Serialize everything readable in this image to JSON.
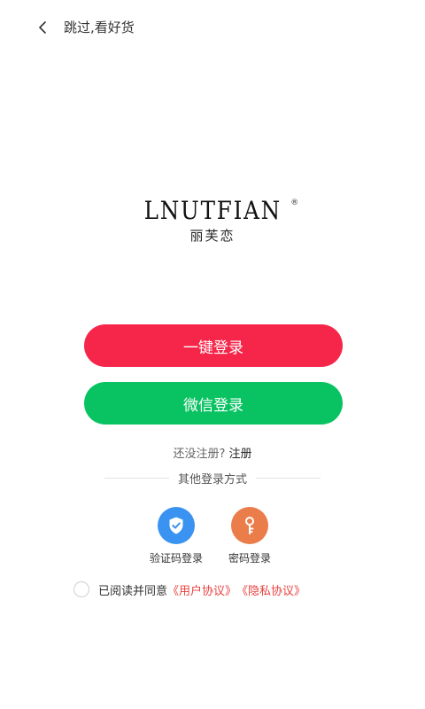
{
  "header": {
    "back_label": "跳过,看好货"
  },
  "logo": {
    "brand": "LNUTFIAN",
    "registered_mark": "®",
    "chinese": "丽芙恋"
  },
  "buttons": {
    "one_key_login": "一键登录",
    "wechat_login": "微信登录"
  },
  "register": {
    "prompt": "还没注册?",
    "link": "注册"
  },
  "divider": {
    "label": "其他登录方式"
  },
  "login_methods": [
    {
      "label": "验证码登录",
      "icon": "shield-check-icon"
    },
    {
      "label": "密码登录",
      "icon": "key-icon"
    }
  ],
  "agreement": {
    "text": "已阅读并同意",
    "user_agreement": "《用户协议》",
    "privacy_agreement": "《隐私协议》",
    "checked": false
  },
  "colors": {
    "one_key_button": "#f5264a",
    "wechat_button": "#09c261",
    "code_login_icon": "#3a93f0",
    "password_login_icon": "#ea7d49",
    "agreement_link": "#e8423f"
  }
}
